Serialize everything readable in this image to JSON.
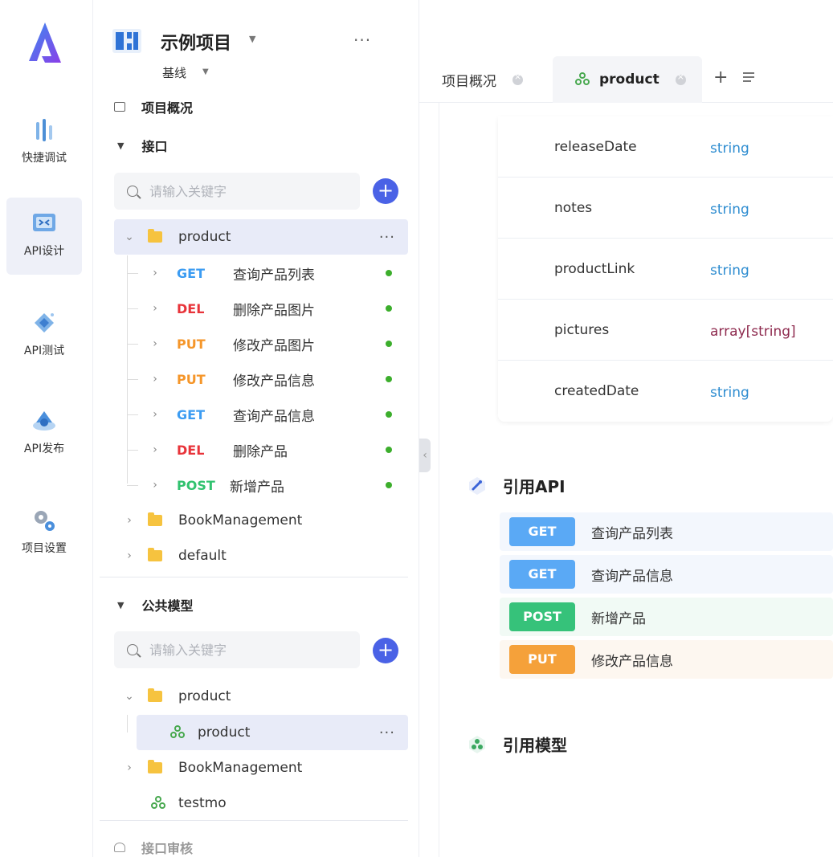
{
  "nav": {
    "items": [
      {
        "label": "快捷调试",
        "icon": "quick-debug-icon"
      },
      {
        "label": "API设计",
        "icon": "api-design-icon",
        "active": true
      },
      {
        "label": "API测试",
        "icon": "api-test-icon"
      },
      {
        "label": "API发布",
        "icon": "api-publish-icon"
      },
      {
        "label": "项目设置",
        "icon": "project-settings-icon"
      }
    ]
  },
  "project": {
    "name": "示例项目",
    "baseline": "基线",
    "more": "···"
  },
  "tree": {
    "overview_label": "项目概况",
    "interfaces_label": "接口",
    "search_placeholder": "请输入关键字",
    "product_folder": "product",
    "endpoints": [
      {
        "method": "GET",
        "name": "查询产品列表"
      },
      {
        "method": "DEL",
        "name": "删除产品图片"
      },
      {
        "method": "PUT",
        "name": "修改产品图片"
      },
      {
        "method": "PUT",
        "name": "修改产品信息"
      },
      {
        "method": "GET",
        "name": "查询产品信息"
      },
      {
        "method": "DEL",
        "name": "删除产品"
      },
      {
        "method": "POST",
        "name": "新增产品"
      }
    ],
    "folders": [
      "BookManagement",
      "default"
    ],
    "models_label": "公共模型",
    "models_search_placeholder": "请输入关键字",
    "model_folder": "product",
    "model_item": "product",
    "model_folder2": "BookManagement",
    "model_item2": "testmo",
    "review_label": "接口审核",
    "more": "···"
  },
  "tabs": [
    {
      "label": "项目概况"
    },
    {
      "label": "product",
      "active": true
    }
  ],
  "fields": [
    {
      "name": "releaseDate",
      "type": "string"
    },
    {
      "name": "notes",
      "type": "string"
    },
    {
      "name": "productLink",
      "type": "string"
    },
    {
      "name": "pictures",
      "type": "array[string]"
    },
    {
      "name": "createdDate",
      "type": "string"
    }
  ],
  "ref_api": {
    "title": "引用API",
    "items": [
      {
        "method": "GET",
        "name": "查询产品列表"
      },
      {
        "method": "GET",
        "name": "查询产品信息"
      },
      {
        "method": "POST",
        "name": "新增产品"
      },
      {
        "method": "PUT",
        "name": "修改产品信息"
      }
    ]
  },
  "ref_model": {
    "title": "引用模型"
  },
  "colors": {
    "get": "#5aa9f5",
    "post": "#36c27a",
    "put": "#f5a13a",
    "del": "#e8343a",
    "accent": "#4a62e6"
  }
}
